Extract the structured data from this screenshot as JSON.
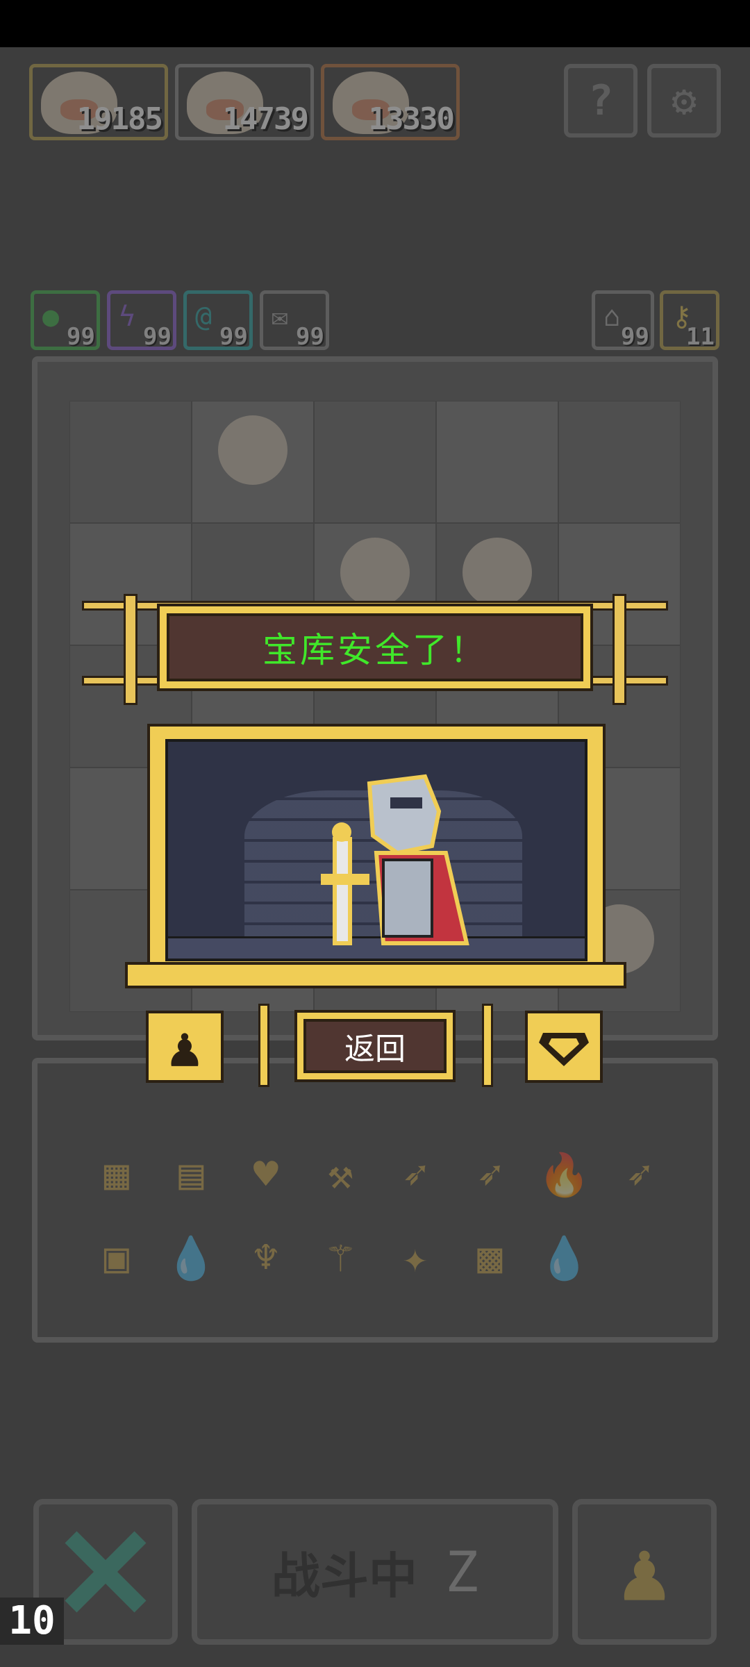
{
  "players": [
    {
      "score": "19185",
      "border": "#b9a24a"
    },
    {
      "score": "14739",
      "border": "#8a8a8a"
    },
    {
      "score": "13330",
      "border": "#b6703c"
    }
  ],
  "system_buttons": {
    "help_label": "?",
    "settings_label": "⚙"
  },
  "resources": [
    {
      "icon": "●",
      "count": "99",
      "color": "#3fb34a"
    },
    {
      "icon": "ϟ",
      "count": "99",
      "color": "#8a5cd6"
    },
    {
      "icon": "@",
      "count": "99",
      "color": "#2aa6a6"
    },
    {
      "icon": "✉",
      "count": "99",
      "color": "#8a8a8a"
    }
  ],
  "right_resources": [
    {
      "icon": "⌂",
      "count": "99"
    },
    {
      "icon": "⚷",
      "count": "11"
    }
  ],
  "inventory_items": [
    "▦",
    "▤",
    "♥",
    "⚒",
    "➶",
    "➶",
    "🔥",
    "➶",
    "▣",
    "💧",
    "♆",
    "⚚",
    "✦",
    "▩",
    "💧"
  ],
  "popup": {
    "title": "宝库安全了！",
    "back_label": "返回"
  },
  "bottom": {
    "battle_label": "战斗中",
    "turn_number": "10"
  },
  "colors": {
    "gold": "#f0cd55",
    "plate": "#503631",
    "title_green": "#40e82a"
  }
}
